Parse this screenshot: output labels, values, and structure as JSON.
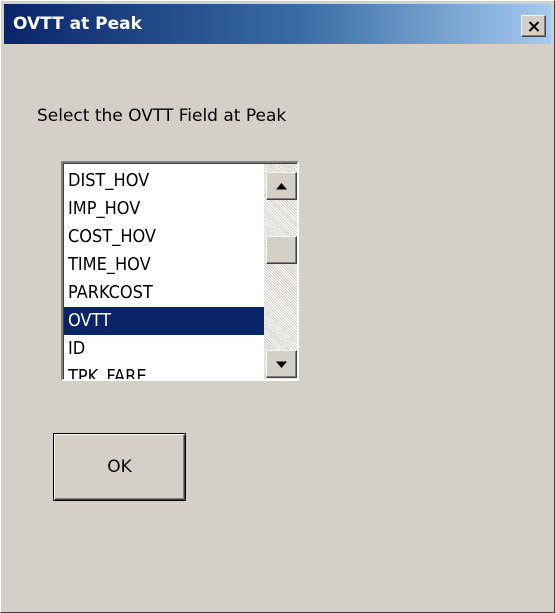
{
  "window": {
    "title": "OVTT at Peak",
    "close_icon": "close-icon"
  },
  "dialog": {
    "prompt": "Select the OVTT Field at Peak",
    "fields": [
      {
        "label": "DIST_HOV",
        "selected": false
      },
      {
        "label": "IMP_HOV",
        "selected": false
      },
      {
        "label": "COST_HOV",
        "selected": false
      },
      {
        "label": "TIME_HOV",
        "selected": false
      },
      {
        "label": "PARKCOST",
        "selected": false
      },
      {
        "label": "OVTT",
        "selected": true
      },
      {
        "label": "ID",
        "selected": false
      },
      {
        "label": "TPK_FARE",
        "selected": false
      }
    ],
    "ok_label": "OK"
  },
  "colors": {
    "titlebar_start": "#0a246a",
    "titlebar_end": "#a6caf0",
    "selection": "#0a246a",
    "face": "#d4d0c8"
  }
}
